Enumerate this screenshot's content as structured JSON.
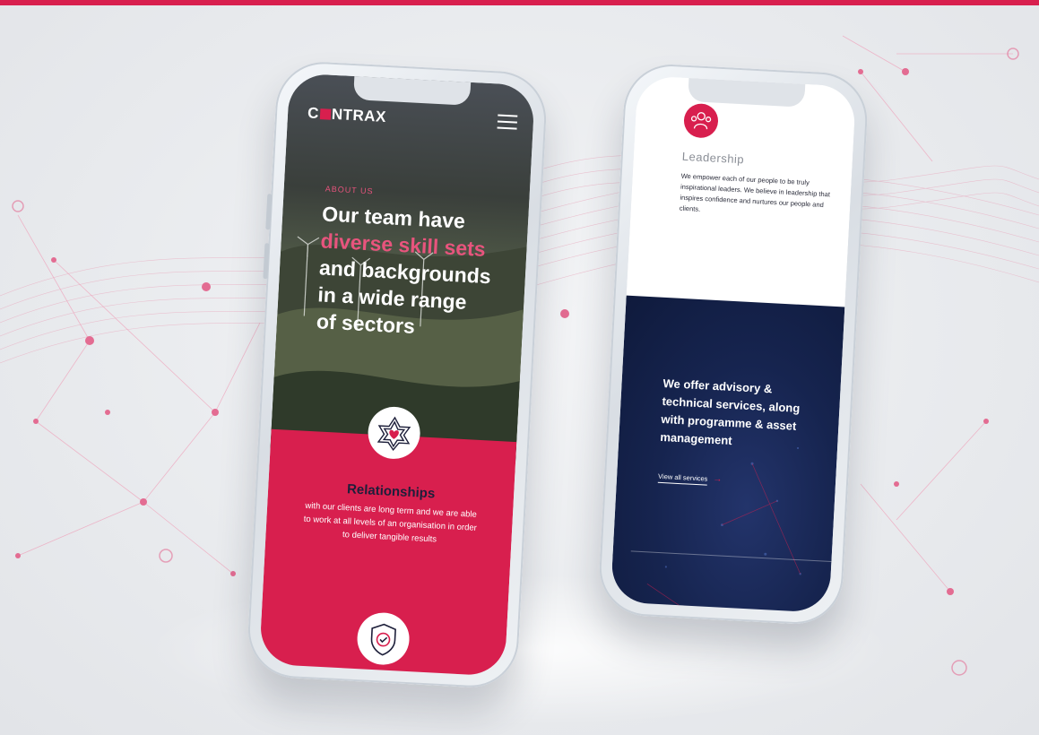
{
  "colors": {
    "accent": "#d81f4e",
    "navy": "#16244f",
    "text_dark": "#1d1f3a"
  },
  "left_phone": {
    "brand_prefix": "C",
    "brand_suffix": "NTRAX",
    "menu_icon": "hamburger-icon",
    "kicker": "ABOUT US",
    "headline": {
      "line1": "Our team have",
      "highlight": "diverse skill sets",
      "line3": "and backgrounds",
      "line4": "in a wide range",
      "line5": "of sectors"
    },
    "feature1": {
      "icon": "mandala-heart-icon",
      "title": "Relationships",
      "body": "with our clients are long term and we are able to work at all levels of an organisation in order to deliver tangible results"
    },
    "feature2": {
      "icon": "shield-check-icon"
    }
  },
  "right_phone": {
    "leadership": {
      "icon": "people-icon",
      "title": "Leadership",
      "body": "We empower each of our people to be truly inspirational leaders. We believe in leadership that inspires confidence and nurtures our people and clients."
    },
    "services": {
      "heading": "We offer advisory & technical services, along with programme & asset management",
      "link_label": "View all services",
      "link_arrow": "→"
    }
  }
}
